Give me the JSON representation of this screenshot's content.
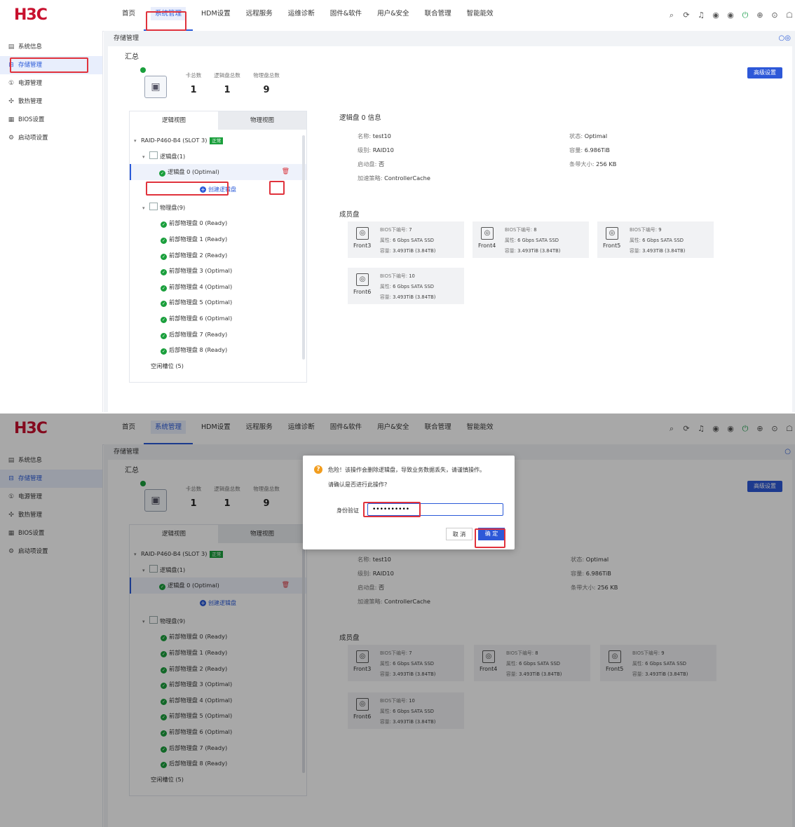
{
  "logo": "H3C",
  "nav": [
    "首页",
    "系统管理",
    "HDM设置",
    "远程服务",
    "运维诊断",
    "固件&软件",
    "用户&安全",
    "联合管理",
    "智能能效"
  ],
  "sidebar": [
    "系统信息",
    "存储管理",
    "电源管理",
    "散热管理",
    "BIOS设置",
    "启动项设置"
  ],
  "breadcrumb": "存储管理",
  "summary": {
    "title": "汇总",
    "labels": [
      "卡总数",
      "逻辑盘总数",
      "物理盘总数"
    ],
    "values": [
      "1",
      "1",
      "9"
    ],
    "advanced_button": "高级设置"
  },
  "tabs": [
    "逻辑视图",
    "物理视图"
  ],
  "tree": {
    "controller": "RAID-P460-B4 (SLOT 3)",
    "status_badge": "正常",
    "logical_group": "逻辑盘(1)",
    "logical_disk": "逻辑盘 0 (Optimal)",
    "create_button": "创建逻辑盘",
    "physical_group": "物理盘(9)",
    "physical_disks": [
      "前部物理盘 0 (Ready)",
      "前部物理盘 1 (Ready)",
      "前部物理盘 2 (Ready)",
      "前部物理盘 3 (Optimal)",
      "前部物理盘 4 (Optimal)",
      "前部物理盘 5 (Optimal)",
      "前部物理盘 6 (Optimal)",
      "后部物理盘 7 (Ready)",
      "后部物理盘 8 (Ready)"
    ],
    "empty_slots": "空闲槽位 (5)"
  },
  "info": {
    "title": "逻辑盘 0 信息",
    "name_k": "名称:",
    "name_v": "test10",
    "level_k": "级别:",
    "level_v": "RAID10",
    "boot_k": "启动盘:",
    "boot_v": "否",
    "accel_k": "加速策略:",
    "accel_v": "ControllerCache",
    "state_k": "状态:",
    "state_v": "Optimal",
    "cap_k": "容量:",
    "cap_v": "6.986TiB",
    "strip_k": "条带大小:",
    "strip_v": "256 KB"
  },
  "members": {
    "title": "成员盘",
    "bios_k": "BIOS下编号:",
    "attr_k": "属性:",
    "cap_k": "容量:",
    "disks": [
      {
        "name": "Front3",
        "bios": "7",
        "attr": "6 Gbps SATA SSD",
        "cap": "3.493TiB (3.84TB)"
      },
      {
        "name": "Front4",
        "bios": "8",
        "attr": "6 Gbps SATA SSD",
        "cap": "3.493TiB (3.84TB)"
      },
      {
        "name": "Front5",
        "bios": "9",
        "attr": "6 Gbps SATA SSD",
        "cap": "3.493TiB (3.84TB)"
      },
      {
        "name": "Front6",
        "bios": "10",
        "attr": "6 Gbps SATA SSD",
        "cap": "3.493TiB (3.84TB)"
      }
    ]
  },
  "dialog": {
    "warning": "危险！该操作会删除逻辑盘，导致业务数据丢失，请谨慎操作。",
    "question": "请确认是否进行此操作?",
    "auth_label": "身份验证",
    "password": "••••••••••",
    "cancel": "取 消",
    "confirm": "确 定"
  },
  "colors": {
    "accent": "#2d58d8",
    "ok": "#1a9f3c",
    "danger": "#e0323c",
    "logo": "#c8102e"
  }
}
